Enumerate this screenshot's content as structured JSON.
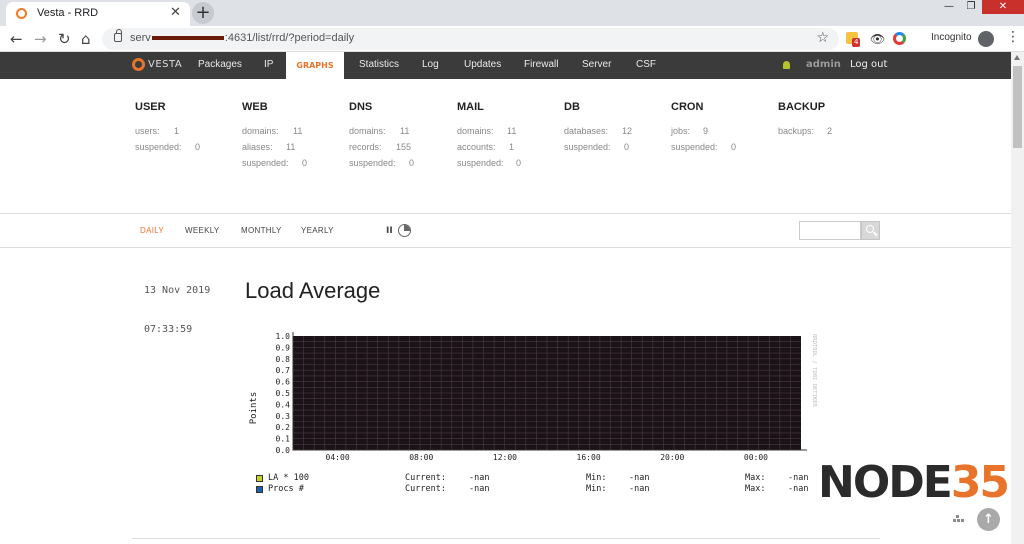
{
  "browser": {
    "tab_title": "Vesta - RRD",
    "url_prefix": "serv",
    "url_suffix": ":4631/list/rrd/?period=daily",
    "incognito_label": "Incognito",
    "extension_badge": "4"
  },
  "nav": {
    "logo_text": "VESTA",
    "items": [
      "Packages",
      "IP",
      "GRAPHS",
      "Statistics",
      "Log",
      "Updates",
      "Firewall",
      "Server",
      "CSF"
    ],
    "user": "admin",
    "logout": "Log out"
  },
  "stats": [
    {
      "head": "USER",
      "lines": [
        [
          "users:",
          "1"
        ],
        [
          "suspended:",
          "0"
        ]
      ]
    },
    {
      "head": "WEB",
      "lines": [
        [
          "domains:",
          "11"
        ],
        [
          "aliases:",
          "11"
        ],
        [
          "suspended:",
          "0"
        ]
      ]
    },
    {
      "head": "DNS",
      "lines": [
        [
          "domains:",
          "11"
        ],
        [
          "records:",
          "155"
        ],
        [
          "suspended:",
          "0"
        ]
      ]
    },
    {
      "head": "MAIL",
      "lines": [
        [
          "domains:",
          "11"
        ],
        [
          "accounts:",
          "1"
        ],
        [
          "suspended:",
          "0"
        ]
      ]
    },
    {
      "head": "DB",
      "lines": [
        [
          "databases:",
          "12"
        ],
        [
          "suspended:",
          "0"
        ]
      ]
    },
    {
      "head": "CRON",
      "lines": [
        [
          "jobs:",
          "9"
        ],
        [
          "suspended:",
          "0"
        ]
      ]
    },
    {
      "head": "BACKUP",
      "lines": [
        [
          "backups:",
          "2"
        ]
      ]
    }
  ],
  "periods": [
    "DAILY",
    "WEEKLY",
    "MONTHLY",
    "YEARLY"
  ],
  "pause_label": "II",
  "graph": {
    "date": "13 Nov 2019",
    "time": "07:33:59",
    "title": "Load Average"
  },
  "chart_data": {
    "type": "line",
    "title": "Load Average",
    "ylabel": "Points",
    "ylim": [
      0,
      1
    ],
    "y_ticks": [
      "0.0",
      "0.1",
      "0.2",
      "0.3",
      "0.4",
      "0.5",
      "0.6",
      "0.7",
      "0.8",
      "0.9",
      "1.0"
    ],
    "x_ticks": [
      "04:00",
      "08:00",
      "12:00",
      "16:00",
      "20:00",
      "00:00"
    ],
    "side_label": "RRDTOOL / TOBI OETIKER",
    "series": [
      {
        "name": "LA * 100",
        "color": "#c8d226",
        "values": []
      },
      {
        "name": "Procs #",
        "color": "#1f5fa8",
        "values": []
      }
    ],
    "legend": [
      {
        "name": "LA * 100",
        "current_label": "Current:",
        "current": "-nan",
        "min_label": "Min:",
        "min": "-nan",
        "max_label": "Max:",
        "max": "-nan"
      },
      {
        "name": "Procs #",
        "current_label": "Current:",
        "current": "-nan",
        "min_label": "Min:",
        "min": "-nan",
        "max_label": "Max:",
        "max": "-nan"
      }
    ],
    "background": "#1a1217",
    "grid_color": "#4a3a44"
  },
  "watermark": {
    "part1": "NODE",
    "part2": "35"
  },
  "colors": {
    "accent": "#e8742b",
    "nav_bg": "#3b3b3b"
  }
}
